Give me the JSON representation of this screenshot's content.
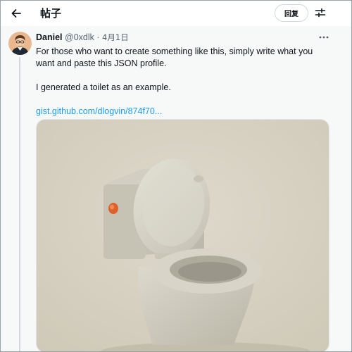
{
  "header": {
    "back_icon": "arrow-left-icon",
    "title": "帖子",
    "reply_label": "回复",
    "settings_icon": "sliders-icon"
  },
  "tweet": {
    "author": {
      "name": "Daniel",
      "handle": "@0xdlk",
      "date": "4月1日",
      "separator": "·"
    },
    "more_icon": "more-horizontal-icon",
    "lines": [
      "For those who want to create something like this, simply write what you",
      "want and paste this JSON profile.",
      "I generated a toilet as an example."
    ],
    "link": "gist.github.com/dlogvin/874f70...",
    "media": {
      "subject": "toilet-render",
      "colors": {
        "background": "#d8d2c3",
        "toilet": "#cfccbd",
        "button": "#e0622b"
      }
    }
  },
  "colors": {
    "link": "#1d9bf0",
    "muted": "#536471",
    "text": "#0f1419"
  }
}
